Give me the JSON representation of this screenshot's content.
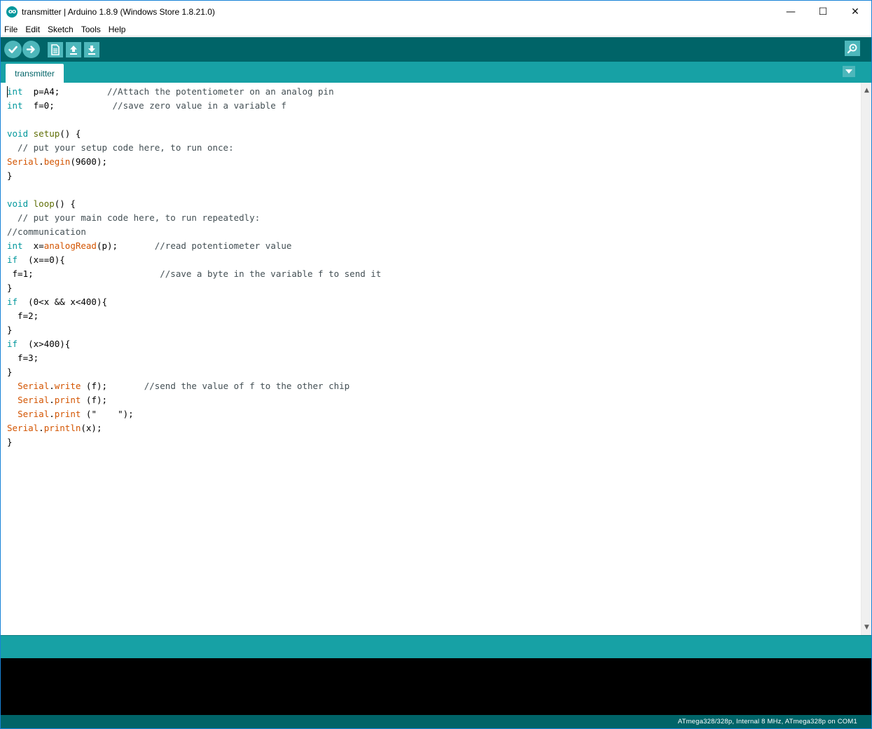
{
  "window": {
    "title": "transmitter | Arduino 1.8.9 (Windows Store 1.8.21.0)",
    "app_icon_text": "oo",
    "minimize_glyph": "—",
    "maximize_glyph": "☐",
    "close_glyph": "✕"
  },
  "menu": [
    "File",
    "Edit",
    "Sketch",
    "Tools",
    "Help"
  ],
  "toolbar": {
    "buttons": [
      "verify-icon",
      "upload-icon",
      "new-icon",
      "open-icon",
      "save-icon"
    ],
    "right_button": "serial-monitor-icon"
  },
  "tabs": [
    {
      "label": "transmitter"
    }
  ],
  "tab_menu_icon": "chevron-down-icon",
  "editor": {
    "lines": [
      [
        [
          "kw",
          "int"
        ],
        [
          "",
          "  p=A4;         "
        ],
        [
          "cm",
          "//Attach the potentiometer on an analog pin"
        ]
      ],
      [
        [
          "kw",
          "int"
        ],
        [
          "",
          "  f=0;           "
        ],
        [
          "cm",
          "//save zero value in a variable f"
        ]
      ],
      [],
      [
        [
          "kw",
          "void"
        ],
        [
          "",
          " "
        ],
        [
          "ck",
          "setup"
        ],
        [
          "",
          "() {"
        ]
      ],
      [
        [
          "cm",
          "  // put your setup code here, to run once:"
        ]
      ],
      [
        [
          "fn",
          "Serial"
        ],
        [
          "",
          "."
        ],
        [
          "fn",
          "begin"
        ],
        [
          "",
          "(9600);"
        ]
      ],
      [
        [
          "",
          "}"
        ]
      ],
      [],
      [
        [
          "kw",
          "void"
        ],
        [
          "",
          " "
        ],
        [
          "ck",
          "loop"
        ],
        [
          "",
          "() {"
        ]
      ],
      [
        [
          "cm",
          "  // put your main code here, to run repeatedly:"
        ]
      ],
      [
        [
          "cm",
          "//communication"
        ]
      ],
      [
        [
          "kw",
          "int"
        ],
        [
          "",
          "  x="
        ],
        [
          "fn",
          "analogRead"
        ],
        [
          "",
          "(p);       "
        ],
        [
          "cm",
          "//read potentiometer value"
        ]
      ],
      [
        [
          "kw",
          "if"
        ],
        [
          "",
          "  (x==0){"
        ]
      ],
      [
        [
          "",
          "",
          " f=1;                        "
        ],
        [
          "cm",
          "//save a byte in the variable f to send it"
        ]
      ],
      [
        [
          "",
          "}"
        ]
      ],
      [
        [
          "kw",
          "if"
        ],
        [
          "",
          "  (0<x && x<400){"
        ]
      ],
      [
        [
          "",
          "  f=2;"
        ]
      ],
      [
        [
          "",
          "}"
        ]
      ],
      [
        [
          "kw",
          "if"
        ],
        [
          "",
          "  (x>400){"
        ]
      ],
      [
        [
          "",
          "  f=3;"
        ]
      ],
      [
        [
          "",
          "}"
        ]
      ],
      [
        [
          "",
          "  "
        ],
        [
          "fn",
          "Serial"
        ],
        [
          "",
          "."
        ],
        [
          "fn",
          "write"
        ],
        [
          "",
          " (f);       "
        ],
        [
          "cm",
          "//send the value of f to the other chip"
        ]
      ],
      [
        [
          "",
          "  "
        ],
        [
          "fn",
          "Serial"
        ],
        [
          "",
          "."
        ],
        [
          "fn",
          "print"
        ],
        [
          "",
          " (f);"
        ]
      ],
      [
        [
          "",
          "  "
        ],
        [
          "fn",
          "Serial"
        ],
        [
          "",
          "."
        ],
        [
          "fn",
          "print"
        ],
        [
          "",
          " (\"    \");"
        ]
      ],
      [
        [
          "fn",
          "Serial"
        ],
        [
          "",
          "."
        ],
        [
          "fn",
          "println"
        ],
        [
          "",
          "(x);"
        ]
      ],
      [
        [
          "",
          "}"
        ]
      ]
    ]
  },
  "scroll": {
    "up": "▲",
    "down": "▼"
  },
  "status": {
    "board": "ATmega328/328p, Internal 8 MHz, ATmega328p on COM1"
  },
  "colors": {
    "toolbar": "#006468",
    "tabbar": "#17a1a5",
    "button": "#4db7bb",
    "keyword": "#00979c",
    "function": "#d35400",
    "structure": "#5e6d03",
    "comment": "#434f54"
  }
}
